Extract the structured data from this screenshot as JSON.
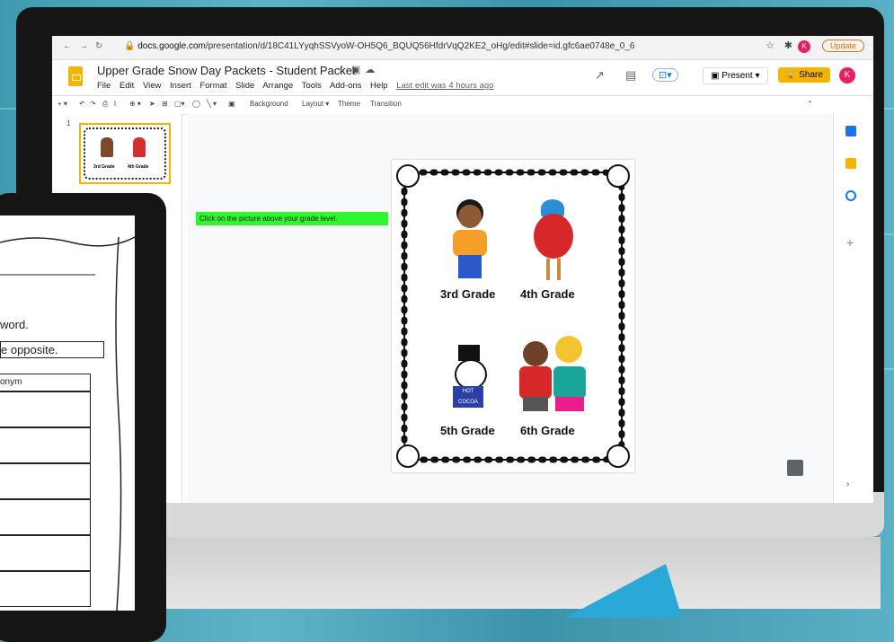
{
  "browser": {
    "url_domain": "docs.google.com",
    "url_path": "/presentation/d/18C41LYyqhSSVyoW-OH5Q6_BQUQ56HfdrVqQ2KE2_oHg/edit#slide=id.gfc6ae0748e_0_6",
    "update_label": "Update",
    "avatar_letter": "K"
  },
  "header": {
    "title": "Upper Grade Snow Day Packets - Student Packet",
    "menu": [
      "File",
      "Edit",
      "View",
      "Insert",
      "Format",
      "Slide",
      "Arrange",
      "Tools",
      "Add-ons",
      "Help"
    ],
    "last_edit": "Last edit was 4 hours ago",
    "present_label": "Present",
    "share_label": "Share",
    "avatar_letter": "K"
  },
  "toolbar": {
    "background_label": "Background",
    "layout_label": "Layout",
    "theme_label": "Theme",
    "transition_label": "Transition"
  },
  "filmstrip": {
    "slide_number": "1",
    "thumb_labels": [
      "3rd Grade",
      "4th Grade"
    ]
  },
  "canvas": {
    "instruction": "Click on the picture above your grade level."
  },
  "slide": {
    "grades": [
      "3rd Grade",
      "4th Grade",
      "5th Grade",
      "6th Grade"
    ],
    "hot_cocoa": "HOT COCOA"
  },
  "tablet": {
    "line1": "word.",
    "line2": "e opposite.",
    "col_header": "onym"
  },
  "colors": {
    "accent_yellow": "#f4b400",
    "avatar_pink": "#e91e63",
    "instruction_green": "#2ef52e"
  }
}
